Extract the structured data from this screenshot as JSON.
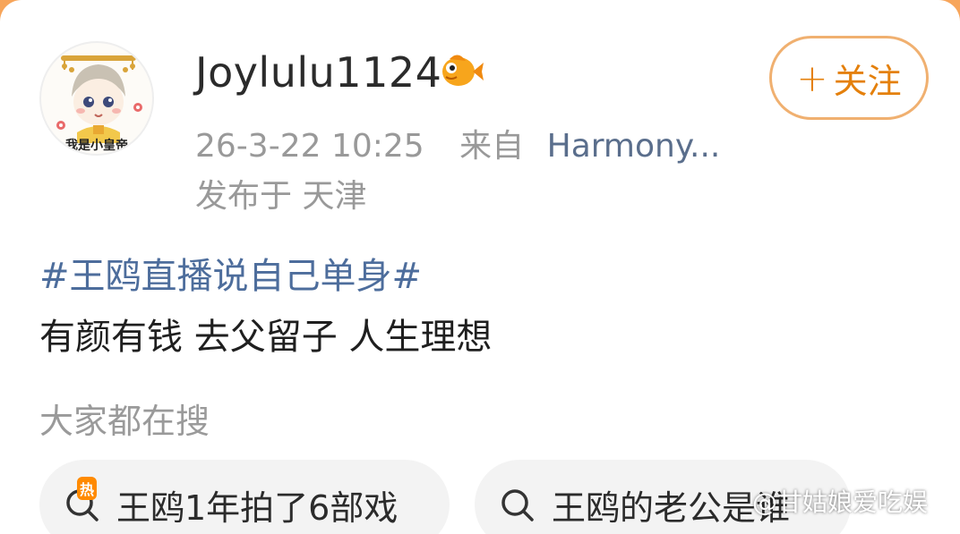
{
  "post": {
    "username": "Joylulu1124",
    "timestamp": "26-3-22 10:25",
    "from_label": "来自",
    "source": "Harmony...",
    "location": "发布于 天津",
    "hashtag": "#王鸥直播说自己单身#",
    "body": "有颜有钱 去父留子 人生理想"
  },
  "avatar": {
    "caption": "我是小皇帝"
  },
  "follow_button": {
    "plus": "+",
    "label": "关注"
  },
  "search_section": {
    "header": "大家都在搜",
    "chips": [
      {
        "label": "王鸥1年拍了6部戏",
        "hot_tag": "热",
        "icon": "search-icon"
      },
      {
        "label": "王鸥的老公是谁",
        "icon": "search-icon"
      }
    ]
  },
  "watermark": "@甘姑娘爱吃娱",
  "colors": {
    "accent_orange": "#e4800c",
    "link_blue": "#4d6d9c",
    "muted_gray": "#999999"
  }
}
